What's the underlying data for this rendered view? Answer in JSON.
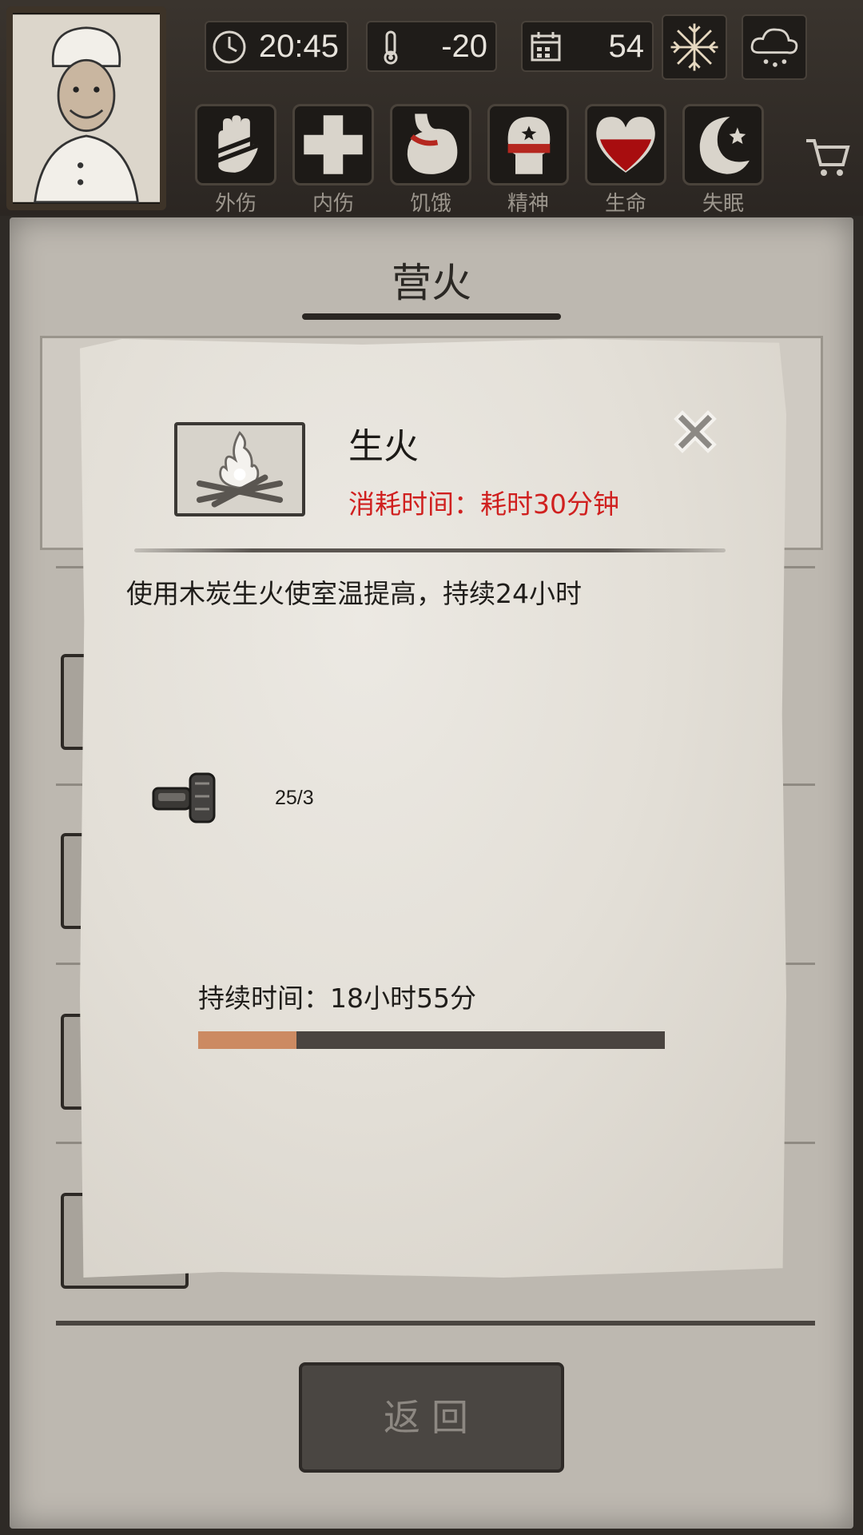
{
  "hud": {
    "clock": "20:45",
    "temperature": "-20",
    "day": "54",
    "clock_icon": "clock-icon",
    "temp_icon": "thermometer-icon",
    "calendar_icon": "calendar-icon",
    "weather_icons": [
      "snowflake-icon",
      "snow-cloud-icon"
    ]
  },
  "status_bar": [
    {
      "label": "外伤",
      "icon": "hand-icon"
    },
    {
      "label": "内伤",
      "icon": "cross-icon"
    },
    {
      "label": "饥饿",
      "icon": "stomach-icon"
    },
    {
      "label": "精神",
      "icon": "head-icon"
    },
    {
      "label": "生命",
      "icon": "heart-icon"
    },
    {
      "label": "失眠",
      "icon": "moon-star-icon"
    }
  ],
  "panel": {
    "title": "营火",
    "back_label": "返回"
  },
  "modal": {
    "item_name": "生火",
    "time_cost": "消耗时间：耗时30分钟",
    "description": "使用木炭生火使室温提高，持续24小时",
    "material_icon": "charcoal-icon",
    "material_count": "25/3",
    "duration_label": "持续时间：18小时55分",
    "duration_progress": 0.21,
    "colors": {
      "time_cost": "#d0201f",
      "progress_fill": "#cc8a62",
      "progress_track": "#4a4440"
    }
  }
}
